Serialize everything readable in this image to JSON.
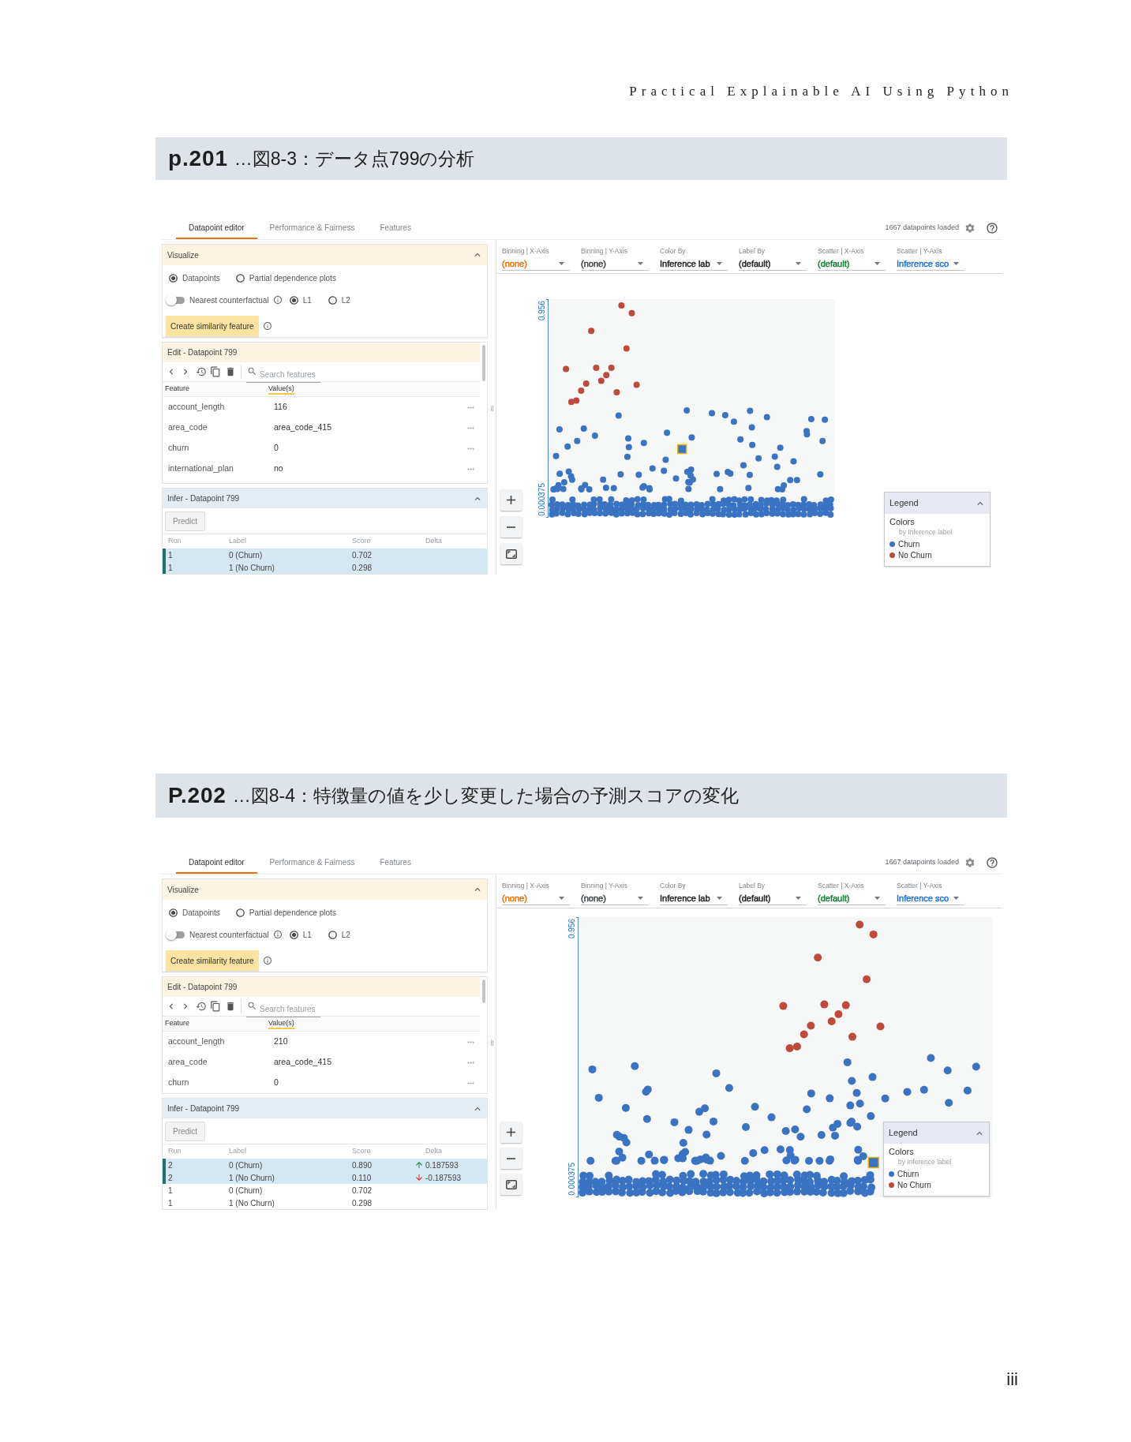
{
  "running_head": "Practical Explainable AI Using Python",
  "figures": [
    {
      "page_ref": "p.201",
      "caption": "…図8-3：データ点799の分析",
      "tabs": [
        {
          "label": "Datapoint editor",
          "selected": true
        },
        {
          "label": "Performance & Fairness",
          "selected": false
        },
        {
          "label": "Features",
          "selected": false
        }
      ],
      "status": "1667 datapoints loaded",
      "visualize": {
        "title": "Visualize",
        "expanded": true,
        "modes": [
          {
            "label": "Datapoints",
            "selected": true
          },
          {
            "label": "Partial dependence plots",
            "selected": false
          }
        ],
        "counterfactual": {
          "label": "Nearest counterfactual",
          "on": false
        },
        "distances": [
          {
            "label": "L1",
            "selected": true
          },
          {
            "label": "L2",
            "selected": false
          }
        ],
        "button": "Create similarity feature"
      },
      "edit": {
        "title": "Edit - Datapoint 799",
        "search": {
          "placeholder": "Search features"
        },
        "columns": [
          "Feature",
          "Value(s)"
        ],
        "rows": [
          {
            "feature": "account_length",
            "value": "116"
          },
          {
            "feature": "area_code",
            "value": "area_code_415"
          },
          {
            "feature": "churn",
            "value": "0"
          },
          {
            "feature": "international_plan",
            "value": "no"
          }
        ]
      },
      "infer": {
        "title": "Infer - Datapoint 799",
        "expanded": true,
        "button": "Predict",
        "columns": [
          "Run",
          "Label",
          "Score",
          "Delta"
        ],
        "rows": [
          {
            "run": "1",
            "label": "0 (Churn)",
            "score": "0.702",
            "selected": true
          },
          {
            "run": "1",
            "label": "1 (No Churn)",
            "score": "0.298",
            "selected": true
          }
        ]
      },
      "controls": [
        {
          "label": "Binning | X-Axis",
          "value": "(none)",
          "color": "#e8710a"
        },
        {
          "label": "Binning | Y-Axis",
          "value": "(none)",
          "color": "#3c4043"
        },
        {
          "label": "Color By",
          "value": "Inference lab",
          "color": "#202124"
        },
        {
          "label": "Label By",
          "value": "(default)",
          "color": "#202124"
        },
        {
          "label": "Scatter | X-Axis",
          "value": "(default)",
          "color": "#188038"
        },
        {
          "label": "Scatter | Y-Axis",
          "value": "Inference sco",
          "color": "#1a73e8"
        }
      ],
      "plot": {
        "y_max": "0.956",
        "y_min": "0.000375"
      },
      "legend": {
        "title": "Legend",
        "expanded": true,
        "heading": "Colors",
        "subheading": "by Inference label",
        "items": [
          {
            "label": "Churn",
            "color": "#3b73c3"
          },
          {
            "label": "No Churn",
            "color": "#bf4a3b"
          }
        ]
      }
    },
    {
      "page_ref": "P.202",
      "caption": "…図8-4：特徴量の値を少し変更した場合の予測スコアの変化",
      "tabs": [
        {
          "label": "Datapoint editor",
          "selected": true
        },
        {
          "label": "Performance & Fairness",
          "selected": false
        },
        {
          "label": "Features",
          "selected": false
        }
      ],
      "status": "1667 datapoints loaded",
      "visualize": {
        "title": "Visualize",
        "expanded": true,
        "modes": [
          {
            "label": "Datapoints",
            "selected": true
          },
          {
            "label": "Partial dependence plots",
            "selected": false
          }
        ],
        "counterfactual": {
          "label": "Nearest counterfactual",
          "on": false
        },
        "distances": [
          {
            "label": "L1",
            "selected": true
          },
          {
            "label": "L2",
            "selected": false
          }
        ],
        "button": "Create similarity feature"
      },
      "edit": {
        "title": "Edit - Datapoint 799",
        "search": {
          "placeholder": "Search features"
        },
        "columns": [
          "Feature",
          "Value(s)"
        ],
        "rows": [
          {
            "feature": "account_length",
            "value": "210"
          },
          {
            "feature": "area_code",
            "value": "area_code_415"
          },
          {
            "feature": "churn",
            "value": "0"
          }
        ]
      },
      "infer": {
        "title": "Infer - Datapoint 799",
        "expanded": true,
        "button": "Predict",
        "columns": [
          "Run",
          "Label",
          "Score",
          "Delta"
        ],
        "rows": [
          {
            "run": "2",
            "label": "0 (Churn)",
            "score": "0.890",
            "delta": "0.187593",
            "up": true,
            "selected": true
          },
          {
            "run": "2",
            "label": "1 (No Churn)",
            "score": "0.110",
            "delta": "-0.187593",
            "up": false,
            "selected": true
          },
          {
            "run": "1",
            "label": "0 (Churn)",
            "score": "0.702",
            "selected": false
          },
          {
            "run": "1",
            "label": "1 (No Churn)",
            "score": "0.298",
            "selected": false
          }
        ]
      },
      "controls": [
        {
          "label": "Binning | X-Axis",
          "value": "(none)",
          "color": "#e8710a"
        },
        {
          "label": "Binning | Y-Axis",
          "value": "(none)",
          "color": "#3c4043"
        },
        {
          "label": "Color By",
          "value": "Inference lab",
          "color": "#202124"
        },
        {
          "label": "Label By",
          "value": "(default)",
          "color": "#202124"
        },
        {
          "label": "Scatter | X-Axis",
          "value": "(default)",
          "color": "#188038"
        },
        {
          "label": "Scatter | Y-Axis",
          "value": "Inference sco",
          "color": "#1a73e8"
        }
      ],
      "plot": {
        "y_max": "0.956",
        "y_min": "0.000375"
      },
      "legend": {
        "title": "Legend",
        "expanded": true,
        "heading": "Colors",
        "subheading": "by Inference label",
        "items": [
          {
            "label": "Churn",
            "color": "#3b73c3"
          },
          {
            "label": "No Churn",
            "color": "#bf4a3b"
          }
        ]
      }
    }
  ],
  "folio": "iii"
}
